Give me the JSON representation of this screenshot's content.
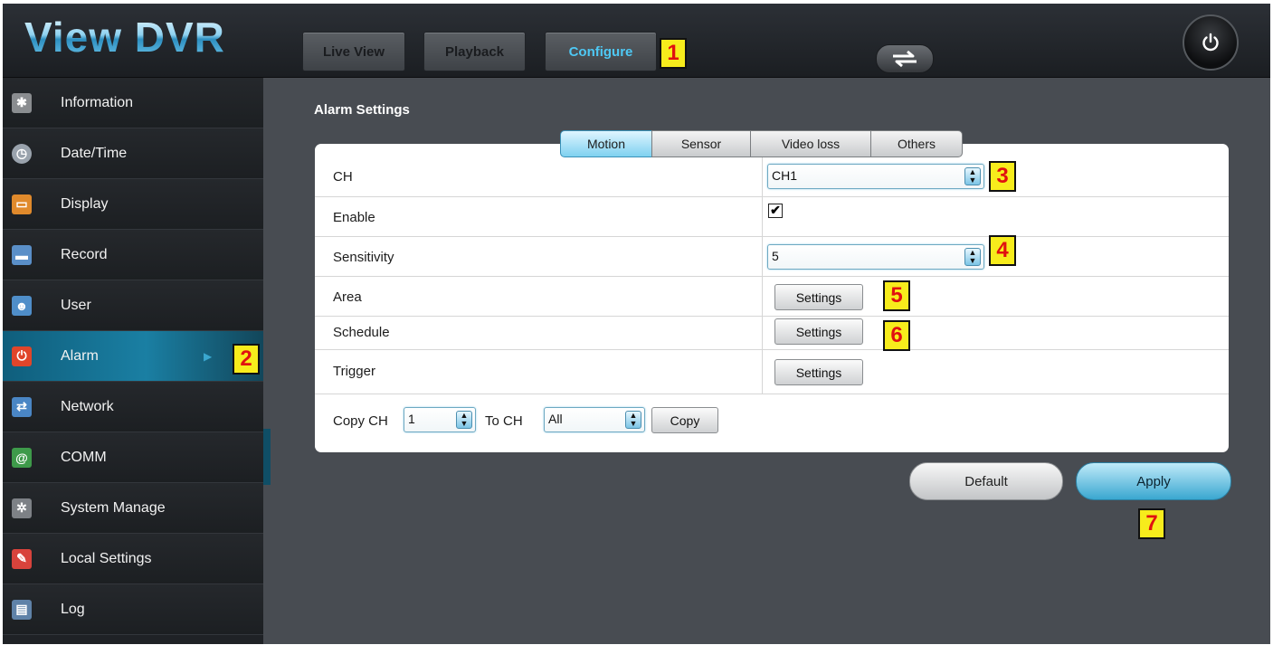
{
  "app": {
    "title": "View DVR",
    "nav": [
      "Live View",
      "Playback",
      "Configure"
    ],
    "active_nav": "Configure"
  },
  "sidebar": {
    "items": [
      {
        "label": "Information",
        "icon": "gear-icon"
      },
      {
        "label": "Date/Time",
        "icon": "clock-icon"
      },
      {
        "label": "Display",
        "icon": "monitor-icon"
      },
      {
        "label": "Record",
        "icon": "record-icon"
      },
      {
        "label": "User",
        "icon": "user-icon"
      },
      {
        "label": "Alarm",
        "icon": "alarm-icon"
      },
      {
        "label": "Network",
        "icon": "network-icon"
      },
      {
        "label": "COMM",
        "icon": "at-sign-icon"
      },
      {
        "label": "System Manage",
        "icon": "system-manage-icon"
      },
      {
        "label": "Local Settings",
        "icon": "local-settings-icon"
      },
      {
        "label": "Log",
        "icon": "log-icon"
      }
    ],
    "active": "Alarm"
  },
  "main": {
    "section_title": "Alarm Settings",
    "tabs": [
      "Motion",
      "Sensor",
      "Video loss",
      "Others"
    ],
    "active_tab": "Motion",
    "rows": {
      "ch": {
        "label": "CH",
        "value": "CH1"
      },
      "enable": {
        "label": "Enable",
        "checked": true,
        "check_glyph": "✔"
      },
      "sensitivity": {
        "label": "Sensitivity",
        "value": "5"
      },
      "area": {
        "label": "Area",
        "button": "Settings"
      },
      "schedule": {
        "label": "Schedule",
        "button": "Settings"
      },
      "trigger": {
        "label": "Trigger",
        "button": "Settings"
      }
    },
    "copy": {
      "copy_ch_label": "Copy CH",
      "copy_ch_value": "1",
      "to_ch_label": "To CH",
      "to_ch_value": "All",
      "copy_button": "Copy"
    },
    "default_button": "Default",
    "apply_button": "Apply"
  },
  "markers": [
    "1",
    "2",
    "3",
    "4",
    "5",
    "6",
    "7"
  ],
  "colors": {
    "accent": "#4ec8f4",
    "marker_bg": "#f7ec1c",
    "marker_text": "#e01010",
    "background": "#484c52",
    "active_sidebar": "#1a7fa3"
  }
}
